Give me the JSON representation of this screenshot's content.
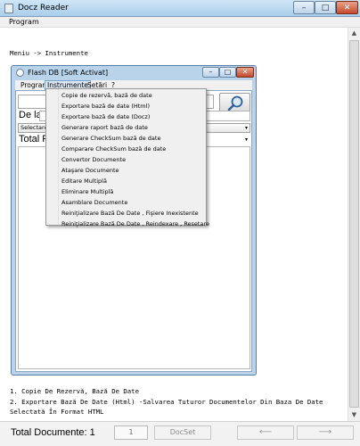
{
  "outer_window": {
    "title": "Docz Reader",
    "menu": [
      "Program"
    ],
    "controls": {
      "minimize": "–",
      "maximize": "□",
      "close": "✕"
    }
  },
  "document": {
    "heading": "Meniu -> Instrumente",
    "lines": [
      "1. Copie De Rezervă, Bază De Date",
      "2. Exportare Bază De Date (Html) -Salvarea Tuturor Documentelor Din Baza De Date",
      "Selectată În Format HTML"
    ]
  },
  "scrollbar": {
    "up": "▲",
    "down": "▼"
  },
  "statusbar": {
    "total_label": "Total Documente: 1",
    "page": "1",
    "docset_label": "DocSet",
    "prev": "⟵",
    "next": "⟶"
  },
  "inner_window": {
    "title": "Flash DB [Soft Activat]",
    "controls": {
      "minimize": "–",
      "maximize": "□",
      "close": "✕"
    },
    "menu": {
      "program": "Program",
      "instrumente": "Instrumente",
      "setari": "Setări",
      "help": "?"
    },
    "de_la_label": "De la:",
    "select_value": "Selectare B",
    "select_chevron": "▾",
    "total_label": "Total Re",
    "search_icon": "magnifier-icon"
  },
  "dropdown": {
    "items": [
      "Copie de rezervă, bază de date",
      "Exportare bază de date (Html)",
      "Exportare bază de date (Docz)",
      "Generare raport bază de date",
      "Generare CheckSum  bază de date",
      "Comparare CheckSum  bază de date",
      "Convertor Documente",
      "Ataşare Documente",
      "Editare Multiplă",
      "Eliminare Multiplă",
      "Asamblare Documente",
      "Reiniţializare Bază De Date , Fişiere Inexistente",
      "Reiniţializare Bază De Date , Reindexare , Resetare"
    ]
  }
}
